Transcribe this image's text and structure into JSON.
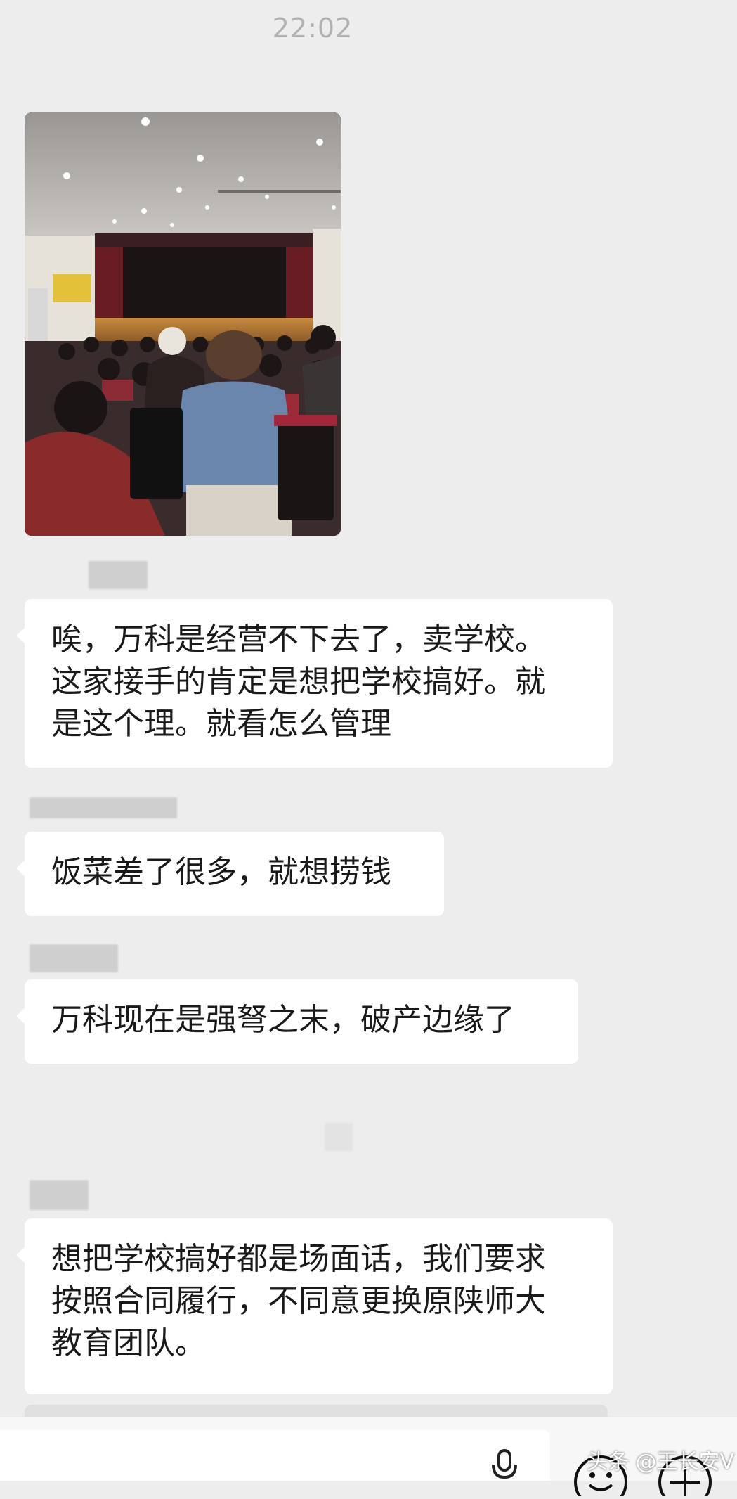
{
  "status": {
    "time": "22:02"
  },
  "messages": [
    {
      "text": "唉，万科是经营不下去了，卖学校。\n这家接手的肯定是想把学校搞好。就\n是这个理。就看怎么管理"
    },
    {
      "text": "饭菜差了很多，就想捞钱"
    },
    {
      "text": "万科现在是强弩之末，破产边缘了"
    },
    {
      "text": "想把学校搞好都是场面话，我们要求\n按照合同履行，不同意更换原陕师大\n教育团队。"
    }
  ],
  "input_bar": {
    "mic_icon": "microphone-icon",
    "emoji_icon": "emoji-icon",
    "plus_icon": "plus-icon"
  },
  "watermark": "头条 @王长安V",
  "colors": {
    "background": "#ededed",
    "bubble": "#ffffff",
    "text": "#1a1a1a"
  }
}
